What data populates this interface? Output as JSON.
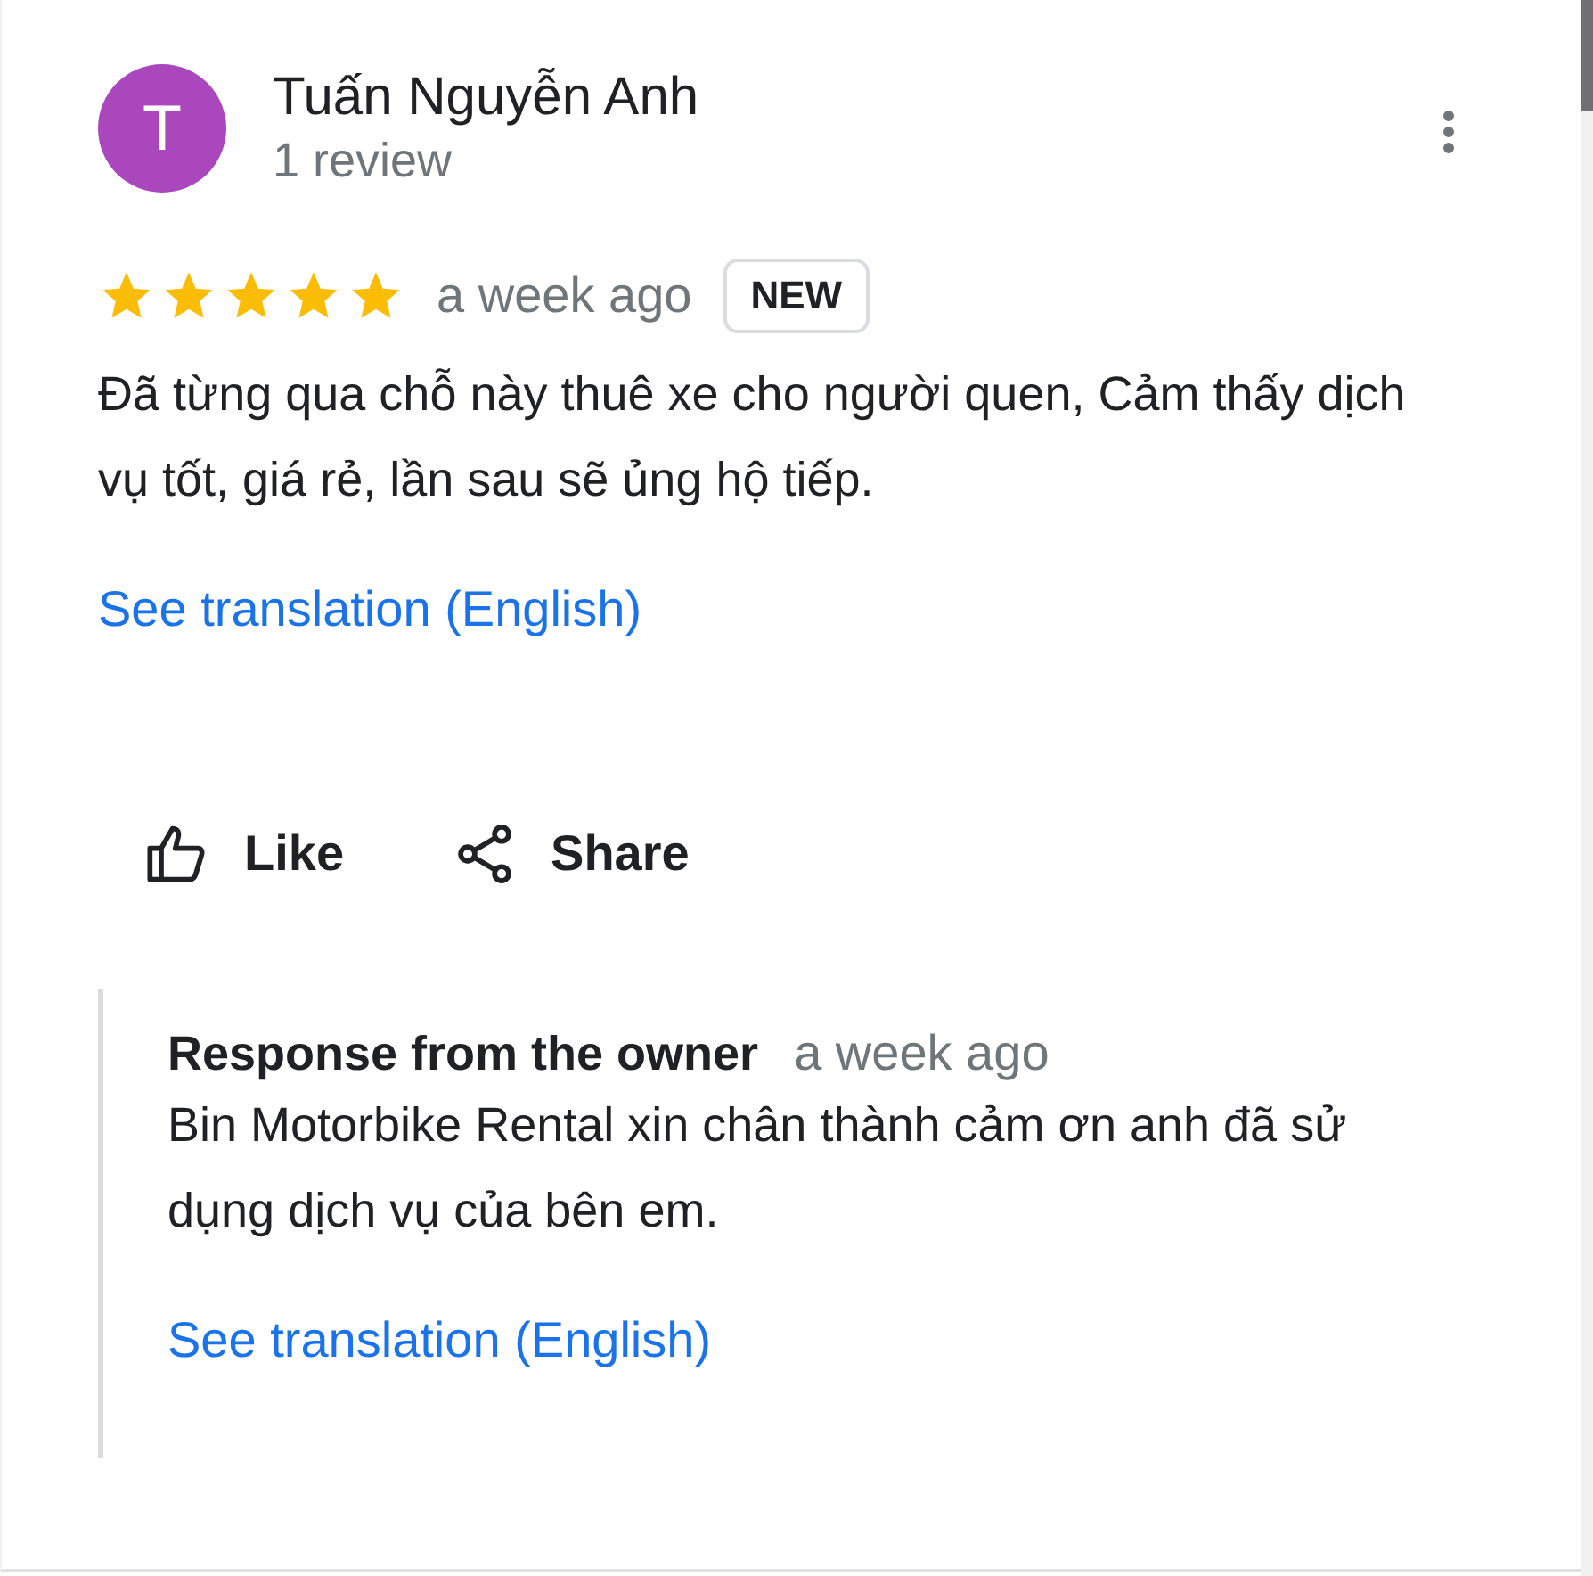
{
  "reviewer": {
    "initial": "T",
    "name": "Tuấn Nguyễn Anh",
    "review_count": "1 review"
  },
  "review": {
    "stars": 5,
    "time": "a week ago",
    "badge": "NEW",
    "text": "Đã từng qua chỗ này thuê xe cho người quen, Cảm thấy dịch vụ tốt, giá rẻ, lần sau sẽ ủng hộ tiếp.",
    "translation_link": "See translation (English)"
  },
  "actions": [
    {
      "kind": "like",
      "label": "Like"
    },
    {
      "kind": "share",
      "label": "Share"
    }
  ],
  "owner_response": {
    "title": "Response from the owner",
    "time": "a week ago",
    "text": "Bin Motorbike Rental xin chân thành cảm ơn anh đã sử dụng dịch vụ của bên em.",
    "translation_link": "See translation (English)"
  }
}
